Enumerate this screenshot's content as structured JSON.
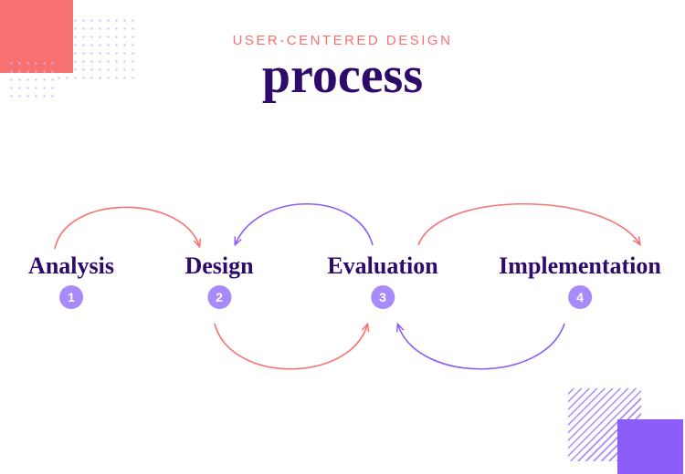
{
  "header": {
    "subtitle": "USER-CENTERED DESIGN",
    "title": "process"
  },
  "steps": [
    {
      "label": "Analysis",
      "num": "1"
    },
    {
      "label": "Design",
      "num": "2"
    },
    {
      "label": "Evaluation",
      "num": "3"
    },
    {
      "label": "Implementation",
      "num": "4"
    }
  ],
  "colors": {
    "coral": "#f87171",
    "purple": "#8b5cf6",
    "deep": "#2e0a6b"
  }
}
